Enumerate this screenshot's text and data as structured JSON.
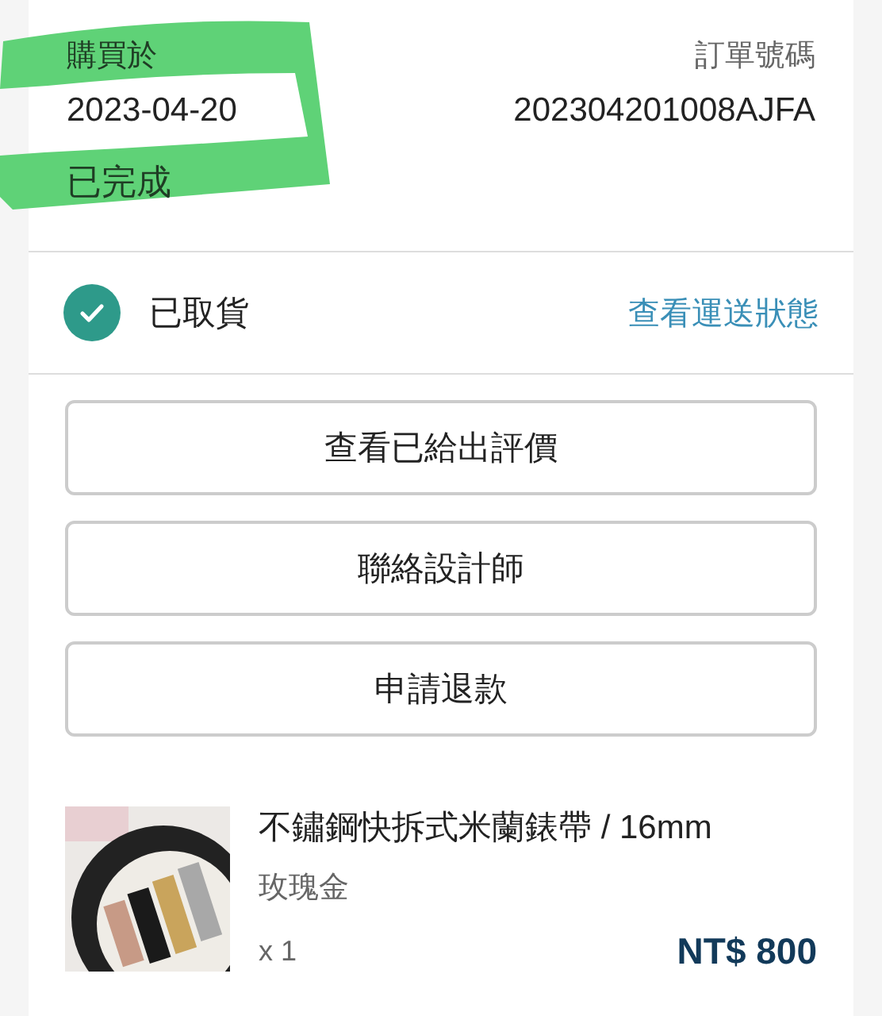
{
  "order": {
    "purchased_label": "購買於",
    "purchased_date": "2023-04-20",
    "number_label": "訂單號碼",
    "number": "202304201008AJFA",
    "status": "已完成"
  },
  "pickup": {
    "checked": true,
    "label": "已取貨",
    "link": "查看運送狀態"
  },
  "buttons": [
    "查看已給出評價",
    "聯絡設計師",
    "申請退款"
  ],
  "product": {
    "name": "不鏽鋼快拆式米蘭錶帶 / 16mm",
    "variant": "玫瑰金",
    "quantity": "x 1",
    "price": "NT$ 800"
  }
}
